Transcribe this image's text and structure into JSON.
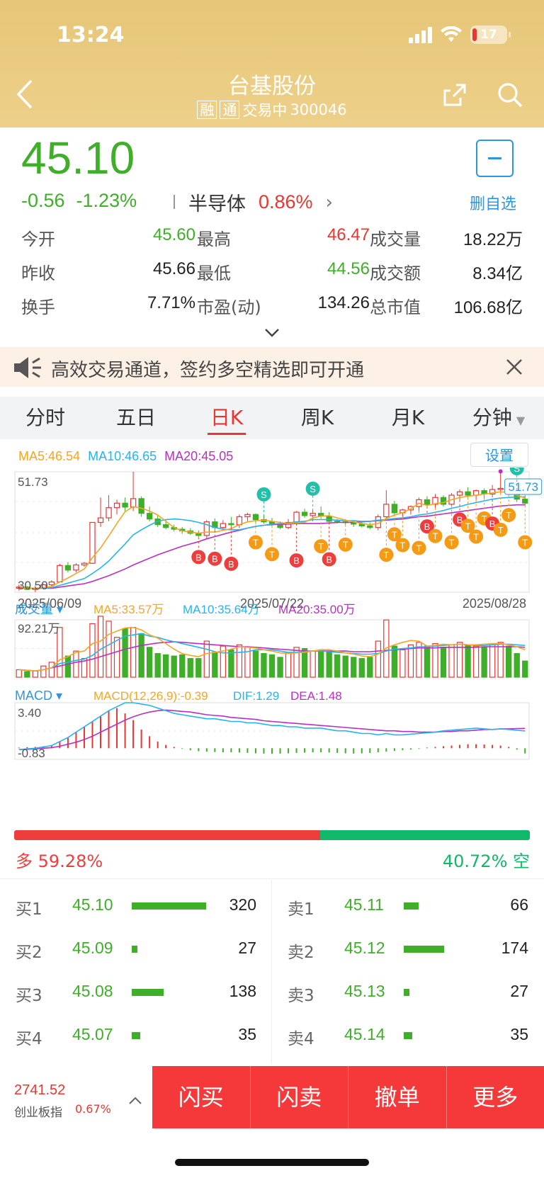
{
  "status": {
    "time": "13:24",
    "battery": "17"
  },
  "nav": {
    "title": "台基股份",
    "tag1": "融",
    "tag2": "通",
    "status": "交易中",
    "code": "300046"
  },
  "quote": {
    "price": "45.10",
    "change": "-0.56",
    "change_pct": "-1.23%",
    "sector": "半导体",
    "sector_pct": "0.86%",
    "fav_label": "删自选"
  },
  "stats": [
    [
      {
        "label": "今开",
        "value": "45.60",
        "color": "#3fae29"
      },
      {
        "label": "最高",
        "value": "46.47",
        "color": "#e83632"
      },
      {
        "label": "成交量",
        "value": "18.22万",
        "color": "#222"
      }
    ],
    [
      {
        "label": "昨收",
        "value": "45.66",
        "color": "#222"
      },
      {
        "label": "最低",
        "value": "44.56",
        "color": "#3fae29"
      },
      {
        "label": "成交额",
        "value": "8.34亿",
        "color": "#222"
      }
    ],
    [
      {
        "label": "换手",
        "value": "7.71%",
        "color": "#222"
      },
      {
        "label": "市盈(动)",
        "value": "134.26",
        "color": "#222"
      },
      {
        "label": "总市值",
        "value": "106.68亿",
        "color": "#222"
      }
    ]
  ],
  "banner": {
    "text": "高效交易通道，签约多空精选即可开通"
  },
  "tabs": [
    "分时",
    "五日",
    "日K",
    "周K",
    "月K",
    "分钟"
  ],
  "active_tab": "日K",
  "ma": {
    "ma5": "MA5:46.54",
    "ma10": "MA10:46.65",
    "ma20": "MA20:45.05",
    "setting": "设置"
  },
  "colors": {
    "up": "#e83632",
    "down": "#3fae29",
    "ma5": "#f5a623",
    "ma10": "#26b4f0",
    "ma20": "#b92fc2"
  },
  "chart_data": [
    {
      "type": "candlestick",
      "title": "日K",
      "ylim": [
        30.5,
        51.73
      ],
      "y_labels": [
        "51.73",
        "30.50"
      ],
      "x_labels": [
        "2025/06/09",
        "2025/07/22",
        "2025/08/28"
      ],
      "ohlc": [
        [
          31.2,
          31.8,
          30.8,
          31.4
        ],
        [
          31.4,
          31.6,
          30.9,
          31.0
        ],
        [
          31.0,
          31.6,
          30.5,
          31.2
        ],
        [
          31.2,
          32.0,
          31.0,
          31.8
        ],
        [
          31.8,
          32.6,
          31.4,
          32.3
        ],
        [
          32.3,
          35.5,
          32.2,
          35.2
        ],
        [
          35.2,
          35.8,
          34.0,
          34.4
        ],
        [
          34.4,
          35.6,
          34.0,
          35.3
        ],
        [
          35.3,
          35.8,
          35.0,
          35.6
        ],
        [
          35.6,
          42.8,
          35.5,
          42.8
        ],
        [
          42.8,
          47.2,
          42.0,
          43.6
        ],
        [
          43.6,
          47.6,
          43.0,
          45.4
        ],
        [
          45.4,
          46.8,
          44.2,
          46.2
        ],
        [
          46.2,
          47.2,
          44.8,
          45.5
        ],
        [
          45.5,
          51.73,
          44.8,
          47.0
        ],
        [
          47.0,
          47.4,
          43.8,
          44.4
        ],
        [
          44.4,
          45.6,
          43.0,
          43.4
        ],
        [
          43.4,
          44.0,
          42.0,
          42.4
        ],
        [
          42.4,
          43.2,
          41.6,
          41.9
        ],
        [
          41.9,
          42.4,
          41.2,
          41.6
        ],
        [
          41.6,
          42.0,
          40.8,
          41.3
        ],
        [
          41.3,
          41.8,
          40.6,
          40.9
        ],
        [
          40.9,
          41.4,
          40.2,
          40.5
        ],
        [
          40.5,
          43.2,
          40.0,
          42.9
        ],
        [
          42.9,
          43.5,
          41.4,
          41.9
        ],
        [
          41.9,
          43.2,
          41.6,
          42.6
        ],
        [
          42.6,
          43.8,
          42.0,
          42.4
        ],
        [
          42.4,
          44.2,
          41.8,
          43.8
        ],
        [
          43.8,
          44.5,
          43.0,
          44.2
        ],
        [
          44.2,
          44.4,
          42.8,
          43.3
        ],
        [
          43.3,
          44.0,
          42.6,
          42.9
        ],
        [
          42.9,
          43.6,
          42.2,
          42.6
        ],
        [
          42.6,
          43.0,
          41.6,
          41.9
        ],
        [
          41.9,
          43.4,
          41.6,
          42.8
        ],
        [
          42.8,
          44.8,
          42.6,
          44.6
        ],
        [
          44.6,
          45.2,
          43.6,
          44.0
        ],
        [
          44.0,
          45.0,
          43.0,
          44.4
        ],
        [
          44.4,
          45.6,
          43.6,
          43.9
        ],
        [
          43.9,
          44.6,
          42.8,
          43.0
        ],
        [
          43.0,
          43.4,
          42.6,
          42.9
        ],
        [
          42.9,
          43.4,
          42.4,
          42.8
        ],
        [
          42.8,
          43.2,
          42.0,
          42.5
        ],
        [
          42.5,
          42.9,
          41.9,
          42.2
        ],
        [
          42.2,
          42.8,
          41.6,
          41.9
        ],
        [
          41.9,
          44.2,
          41.4,
          43.8
        ],
        [
          43.8,
          48.5,
          43.6,
          46.0
        ],
        [
          46.0,
          46.6,
          44.2,
          44.5
        ],
        [
          44.5,
          45.2,
          43.8,
          45.0
        ],
        [
          45.0,
          45.8,
          44.2,
          45.6
        ],
        [
          45.6,
          47.2,
          44.8,
          46.8
        ],
        [
          46.8,
          47.4,
          45.6,
          46.0
        ],
        [
          46.0,
          47.8,
          45.4,
          47.2
        ],
        [
          47.2,
          47.6,
          45.6,
          46.0
        ],
        [
          46.0,
          48.0,
          45.8,
          47.6
        ],
        [
          47.6,
          48.6,
          46.8,
          48.2
        ],
        [
          48.2,
          49.0,
          47.2,
          47.6
        ],
        [
          47.6,
          48.6,
          46.8,
          48.4
        ],
        [
          48.4,
          48.8,
          47.0,
          47.8
        ],
        [
          47.8,
          49.4,
          47.6,
          48.6
        ],
        [
          48.6,
          51.8,
          48.0,
          48.8
        ],
        [
          48.8,
          49.8,
          47.6,
          48.2
        ],
        [
          48.2,
          48.6,
          46.4,
          46.9
        ],
        [
          46.9,
          47.6,
          45.8,
          46.2
        ]
      ],
      "ma5": [
        31.2,
        31.2,
        31.2,
        31.3,
        31.5,
        32.3,
        33.0,
        33.8,
        34.6,
        36.6,
        38.3,
        40.4,
        42.6,
        44.7,
        45.6,
        45.3,
        44.8,
        44.1,
        43.0,
        41.9,
        41.3,
        41.1,
        40.9,
        41.1,
        41.1,
        41.4,
        41.7,
        42.4,
        42.9,
        43.1,
        43.2,
        43.0,
        42.8,
        42.6,
        42.7,
        42.8,
        43.6,
        43.9,
        44.0,
        43.6,
        43.2,
        42.9,
        42.6,
        42.4,
        42.6,
        43.5,
        44.1,
        44.5,
        45.2,
        46.2,
        45.8,
        46.1,
        46.3,
        46.8,
        47.2,
        47.4,
        47.6,
        47.8,
        48.0,
        48.2,
        48.1,
        47.6,
        47.1
      ],
      "ma10": [
        31.2,
        31.2,
        31.2,
        31.2,
        31.3,
        31.7,
        32.1,
        32.5,
        32.9,
        33.8,
        34.8,
        36.0,
        37.5,
        39.0,
        40.6,
        41.5,
        42.3,
        43.0,
        43.3,
        43.4,
        43.3,
        43.1,
        42.8,
        42.4,
        41.9,
        41.6,
        41.5,
        41.5,
        41.8,
        42.1,
        42.3,
        42.5,
        42.6,
        42.7,
        42.9,
        43.0,
        43.3,
        43.3,
        43.3,
        43.2,
        43.1,
        43.1,
        43.0,
        43.0,
        43.2,
        43.3,
        43.5,
        43.6,
        43.8,
        44.1,
        44.3,
        44.6,
        44.9,
        45.3,
        45.6,
        46.0,
        46.3,
        46.6,
        46.9,
        47.1,
        47.2,
        47.3,
        47.3
      ],
      "ma20": [
        31.2,
        31.2,
        31.2,
        31.2,
        31.2,
        31.4,
        31.6,
        31.8,
        32.0,
        32.4,
        32.9,
        33.4,
        34.0,
        34.6,
        35.3,
        35.9,
        36.5,
        37.1,
        37.6,
        38.1,
        38.6,
        39.0,
        39.4,
        39.9,
        40.3,
        40.7,
        41.1,
        41.4,
        41.8,
        42.1,
        42.3,
        42.4,
        42.5,
        42.5,
        42.6,
        42.6,
        42.6,
        42.6,
        42.7,
        42.8,
        42.8,
        42.8,
        42.9,
        43.0,
        43.1,
        43.2,
        43.3,
        43.4,
        43.6,
        43.8,
        43.9,
        44.1,
        44.3,
        44.5,
        44.7,
        44.9,
        45.1,
        45.3,
        45.5,
        45.7,
        45.8,
        45.9,
        45.9
      ],
      "markers": [
        {
          "i": 22,
          "t": "B"
        },
        {
          "i": 24,
          "t": "B"
        },
        {
          "i": 26,
          "t": "B"
        },
        {
          "i": 29,
          "t": "T"
        },
        {
          "i": 31,
          "t": "T"
        },
        {
          "i": 34,
          "t": "B"
        },
        {
          "i": 30,
          "t": "S",
          "top": true
        },
        {
          "i": 37,
          "t": "T"
        },
        {
          "i": 38,
          "t": "B"
        },
        {
          "i": 40,
          "t": "T"
        },
        {
          "i": 36,
          "t": "S",
          "top": true
        },
        {
          "i": 45,
          "t": "T"
        },
        {
          "i": 46,
          "t": "T"
        },
        {
          "i": 47,
          "t": "T"
        },
        {
          "i": 49,
          "t": "T"
        },
        {
          "i": 50,
          "t": "B"
        },
        {
          "i": 51,
          "t": "T"
        },
        {
          "i": 53,
          "t": "T"
        },
        {
          "i": 54,
          "t": "B"
        },
        {
          "i": 55,
          "t": "T"
        },
        {
          "i": 56,
          "t": "T"
        },
        {
          "i": 57,
          "t": "T"
        },
        {
          "i": 58,
          "t": "B"
        },
        {
          "i": 59,
          "t": "T"
        },
        {
          "i": 60,
          "t": "T"
        },
        {
          "i": 61,
          "t": "S",
          "top": true
        },
        {
          "i": 62,
          "t": "T"
        }
      ]
    },
    {
      "type": "bar",
      "title": "成交量",
      "ma5": "MA5:33.57万",
      "ma10": "MA10:35.64万",
      "ma20": "MA20:35.00万",
      "max_label": "92.21万",
      "ylim": [
        0,
        92.21
      ],
      "values": [
        12,
        9,
        10,
        18,
        24,
        80,
        34,
        42,
        30,
        86,
        98,
        90,
        64,
        78,
        80,
        70,
        48,
        38,
        36,
        34,
        36,
        30,
        30,
        58,
        40,
        50,
        44,
        52,
        48,
        42,
        38,
        36,
        32,
        40,
        48,
        46,
        42,
        44,
        40,
        36,
        34,
        32,
        30,
        32,
        58,
        92,
        50,
        44,
        52,
        56,
        50,
        54,
        48,
        52,
        56,
        52,
        50,
        48,
        54,
        56,
        50,
        38,
        26
      ],
      "ma5_vals": [
        12,
        11,
        10,
        12,
        15,
        28,
        33,
        40,
        42,
        54,
        58,
        69,
        74,
        79,
        80,
        76,
        68,
        63,
        54,
        45,
        38,
        35,
        33,
        38,
        40,
        42,
        45,
        49,
        48,
        47,
        44,
        42,
        39,
        38,
        39,
        40,
        42,
        44,
        44,
        42,
        39,
        37,
        34,
        33,
        37,
        47,
        52,
        56,
        59,
        58,
        50,
        51,
        53,
        52,
        53,
        52,
        52,
        53,
        54,
        54,
        52,
        49,
        44
      ],
      "ma10_vals": [
        12,
        11,
        10,
        12,
        15,
        22,
        24,
        27,
        29,
        35,
        45,
        52,
        59,
        66,
        68,
        70,
        66,
        64,
        60,
        57,
        54,
        51,
        48,
        45,
        41,
        39,
        39,
        40,
        41,
        44,
        44,
        44,
        42,
        40,
        40,
        41,
        42,
        42,
        41,
        40,
        39,
        38,
        37,
        37,
        38,
        42,
        45,
        46,
        47,
        49,
        49,
        50,
        51,
        52,
        53,
        52,
        51,
        51,
        52,
        53,
        53,
        52,
        51
      ],
      "ma20_vals": [
        12,
        11,
        10,
        12,
        15,
        18,
        21,
        24,
        26,
        29,
        33,
        37,
        41,
        45,
        48,
        51,
        53,
        55,
        56,
        57,
        56,
        55,
        54,
        53,
        52,
        51,
        50,
        49,
        49,
        48,
        47,
        46,
        45,
        44,
        43,
        42,
        42,
        42,
        42,
        42,
        42,
        41,
        41,
        41,
        42,
        43,
        44,
        45,
        46,
        47,
        47,
        47,
        48,
        48,
        48,
        48,
        48,
        49,
        49,
        49,
        49,
        49,
        48
      ]
    },
    {
      "type": "bar",
      "title": "MACD",
      "label": "MACD(12,26,9):-0.39",
      "dif_label": "DIF:1.29",
      "dea_label": "DEA:1.48",
      "max_label": "3.40",
      "min_label": "-0.83",
      "ylim": [
        -0.83,
        3.4
      ],
      "macd": [
        0.05,
        0.08,
        0.1,
        0.15,
        0.2,
        0.5,
        0.8,
        1.2,
        1.6,
        2.0,
        2.4,
        2.8,
        3.0,
        2.6,
        2.1,
        1.4,
        0.9,
        0.5,
        0.25,
        0.1,
        -0.05,
        -0.15,
        -0.22,
        -0.25,
        -0.28,
        -0.3,
        -0.3,
        -0.32,
        -0.35,
        -0.38,
        -0.4,
        -0.42,
        -0.4,
        -0.38,
        -0.35,
        -0.33,
        -0.3,
        -0.3,
        -0.32,
        -0.35,
        -0.38,
        -0.4,
        -0.38,
        -0.35,
        -0.3,
        -0.25,
        -0.2,
        -0.15,
        -0.1,
        -0.05,
        0.05,
        0.1,
        0.15,
        0.2,
        0.25,
        0.3,
        0.3,
        0.28,
        0.25,
        0.2,
        0.1,
        -0.1,
        -0.39
      ],
      "dif": [
        -0.1,
        -0.05,
        0.0,
        0.1,
        0.2,
        0.5,
        0.8,
        1.2,
        1.6,
        2.0,
        2.4,
        2.8,
        3.1,
        3.4,
        3.4,
        3.3,
        3.2,
        3.0,
        2.8,
        2.6,
        2.5,
        2.4,
        2.3,
        2.2,
        2.2,
        2.1,
        2.0,
        2.0,
        1.9,
        1.9,
        1.8,
        1.7,
        1.7,
        1.6,
        1.6,
        1.5,
        1.5,
        1.5,
        1.4,
        1.3,
        1.3,
        1.2,
        1.1,
        1.1,
        1.0,
        1.1,
        1.0,
        1.0,
        1.05,
        1.1,
        1.15,
        1.2,
        1.3,
        1.35,
        1.4,
        1.45,
        1.5,
        1.45,
        1.4,
        1.45,
        1.4,
        1.35,
        1.29
      ],
      "dea": [
        -0.1,
        -0.08,
        -0.05,
        0.0,
        0.05,
        0.15,
        0.3,
        0.45,
        0.65,
        0.9,
        1.2,
        1.5,
        1.8,
        2.1,
        2.35,
        2.55,
        2.7,
        2.8,
        2.85,
        2.8,
        2.75,
        2.7,
        2.6,
        2.5,
        2.45,
        2.4,
        2.3,
        2.25,
        2.2,
        2.15,
        2.05,
        2.0,
        1.95,
        1.9,
        1.85,
        1.8,
        1.75,
        1.7,
        1.65,
        1.6,
        1.55,
        1.5,
        1.45,
        1.4,
        1.35,
        1.3,
        1.3,
        1.25,
        1.25,
        1.2,
        1.2,
        1.2,
        1.25,
        1.25,
        1.3,
        1.3,
        1.35,
        1.4,
        1.4,
        1.45,
        1.45,
        1.47,
        1.48
      ]
    }
  ],
  "distribution": {
    "long_label": "多 59.28%",
    "short_label": "40.72% 空",
    "long_pct": 59.28
  },
  "order_book": {
    "bids": [
      {
        "label": "买1",
        "price": "45.10",
        "qty": "320",
        "bar": 100
      },
      {
        "label": "买2",
        "price": "45.09",
        "qty": "27",
        "bar": 8
      },
      {
        "label": "买3",
        "price": "45.08",
        "qty": "138",
        "bar": 43
      },
      {
        "label": "买4",
        "price": "45.07",
        "qty": "35",
        "bar": 11
      }
    ],
    "asks": [
      {
        "label": "卖1",
        "price": "45.11",
        "qty": "66",
        "bar": 20
      },
      {
        "label": "卖2",
        "price": "45.12",
        "qty": "174",
        "bar": 54
      },
      {
        "label": "卖3",
        "price": "45.13",
        "qty": "27",
        "bar": 8
      },
      {
        "label": "卖4",
        "price": "45.14",
        "qty": "35",
        "bar": 11
      }
    ]
  },
  "bottom": {
    "index_value": "2741.52",
    "index_name": "创业板指",
    "index_pct": "0.67%",
    "actions": [
      "闪买",
      "闪卖",
      "撤单",
      "更多"
    ]
  }
}
